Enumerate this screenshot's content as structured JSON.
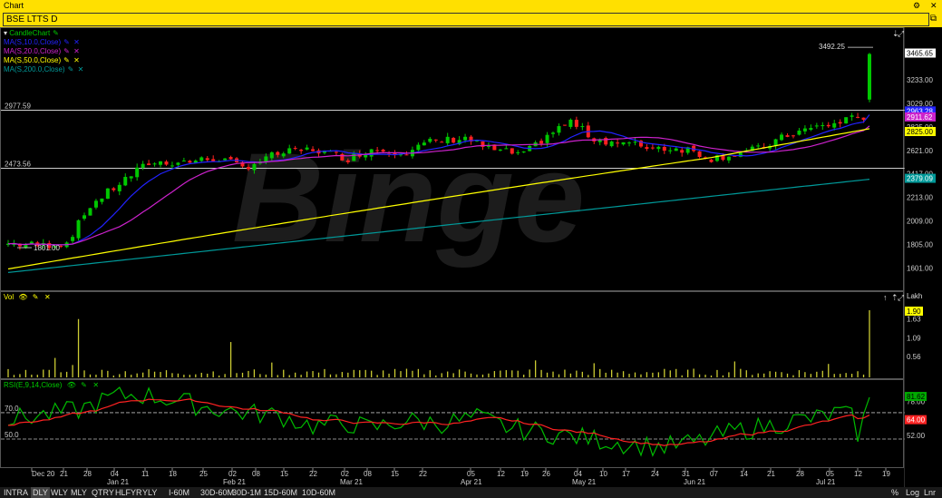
{
  "window": {
    "title": "Chart"
  },
  "chart_tab": {
    "label": "BSE LTTS D"
  },
  "price_panel": {
    "legend": [
      {
        "label": "CandleChart",
        "color": "#00c800"
      },
      {
        "label": "MA(S,10.0,Close)",
        "color": "#2222ff"
      },
      {
        "label": "MA(S,20.0,Close)",
        "color": "#cc22cc"
      },
      {
        "label": "MA(S,50.0,Close)",
        "color": "#ffff00"
      },
      {
        "label": "MA(S,200.0,Close)",
        "color": "#009999"
      }
    ],
    "hlines": [
      {
        "label": "2977.59",
        "value": 2977.59
      },
      {
        "label": "2473.56",
        "value": 2473.56
      }
    ],
    "annotation_high": "3492.25",
    "annotation_low": "1801.00",
    "watermark": "Binge",
    "y_ticks": [
      "3233.00",
      "3029.00",
      "2825.00",
      "2621.00",
      "2417.00",
      "2213.00",
      "2009.00",
      "1805.00",
      "1601.00"
    ],
    "tags": [
      {
        "label": "3465.65",
        "bg": "#ffffff",
        "fg": "#000000",
        "value": 3465.65
      },
      {
        "label": "2963.28",
        "bg": "#2222ff",
        "fg": "#ffffff",
        "value": 2963.28
      },
      {
        "label": "2911.62",
        "bg": "#cc22cc",
        "fg": "#ffffff",
        "value": 2911.62
      },
      {
        "label": "2825.00",
        "bg": "#ffff00",
        "fg": "#000000",
        "value": 2785
      },
      {
        "label": "2379.09",
        "bg": "#009999",
        "fg": "#ffffff",
        "value": 2379.09
      }
    ]
  },
  "volume_panel": {
    "legend": "Vol",
    "unit": "Lakh",
    "y_ticks": [
      "1.63",
      "1.09",
      "0.56"
    ],
    "current_tag": "1.90"
  },
  "rsi_panel": {
    "legend": "RSI(E,9,14,Close)",
    "levels": [
      "70.0",
      "50.0"
    ],
    "y_ticks": [
      "78.00",
      "52.00"
    ],
    "tags": [
      {
        "label": "81.62",
        "bg": "#00aa00",
        "fg": "#000000"
      },
      {
        "label": "64.00",
        "bg": "#ff2222",
        "fg": "#ffffff"
      }
    ]
  },
  "x_axis": {
    "labels": [
      "Dec 20",
      "21",
      "28",
      "04",
      "11",
      "18",
      "25",
      "02",
      "08",
      "15",
      "22",
      "02",
      "08",
      "15",
      "22",
      "05",
      "12",
      "19",
      "26",
      "04",
      "10",
      "17",
      "24",
      "31",
      "07",
      "14",
      "21",
      "28",
      "05",
      "12",
      "19"
    ],
    "months": [
      "Jan 21",
      "Feb 21",
      "Mar 21",
      "Apr 21",
      "May 21",
      "Jun 21",
      "Jul 21"
    ]
  },
  "timeframes": [
    "INTRA",
    "DLY",
    "WLY",
    "MLY",
    "QTRY",
    "HLFYR",
    "YLY",
    "I-60M",
    "30D-60M",
    "30D-1M",
    "15D-60M",
    "10D-60M"
  ],
  "active_timeframe": "DLY",
  "bottom_right": [
    "%",
    "Log",
    "Lnr"
  ]
}
